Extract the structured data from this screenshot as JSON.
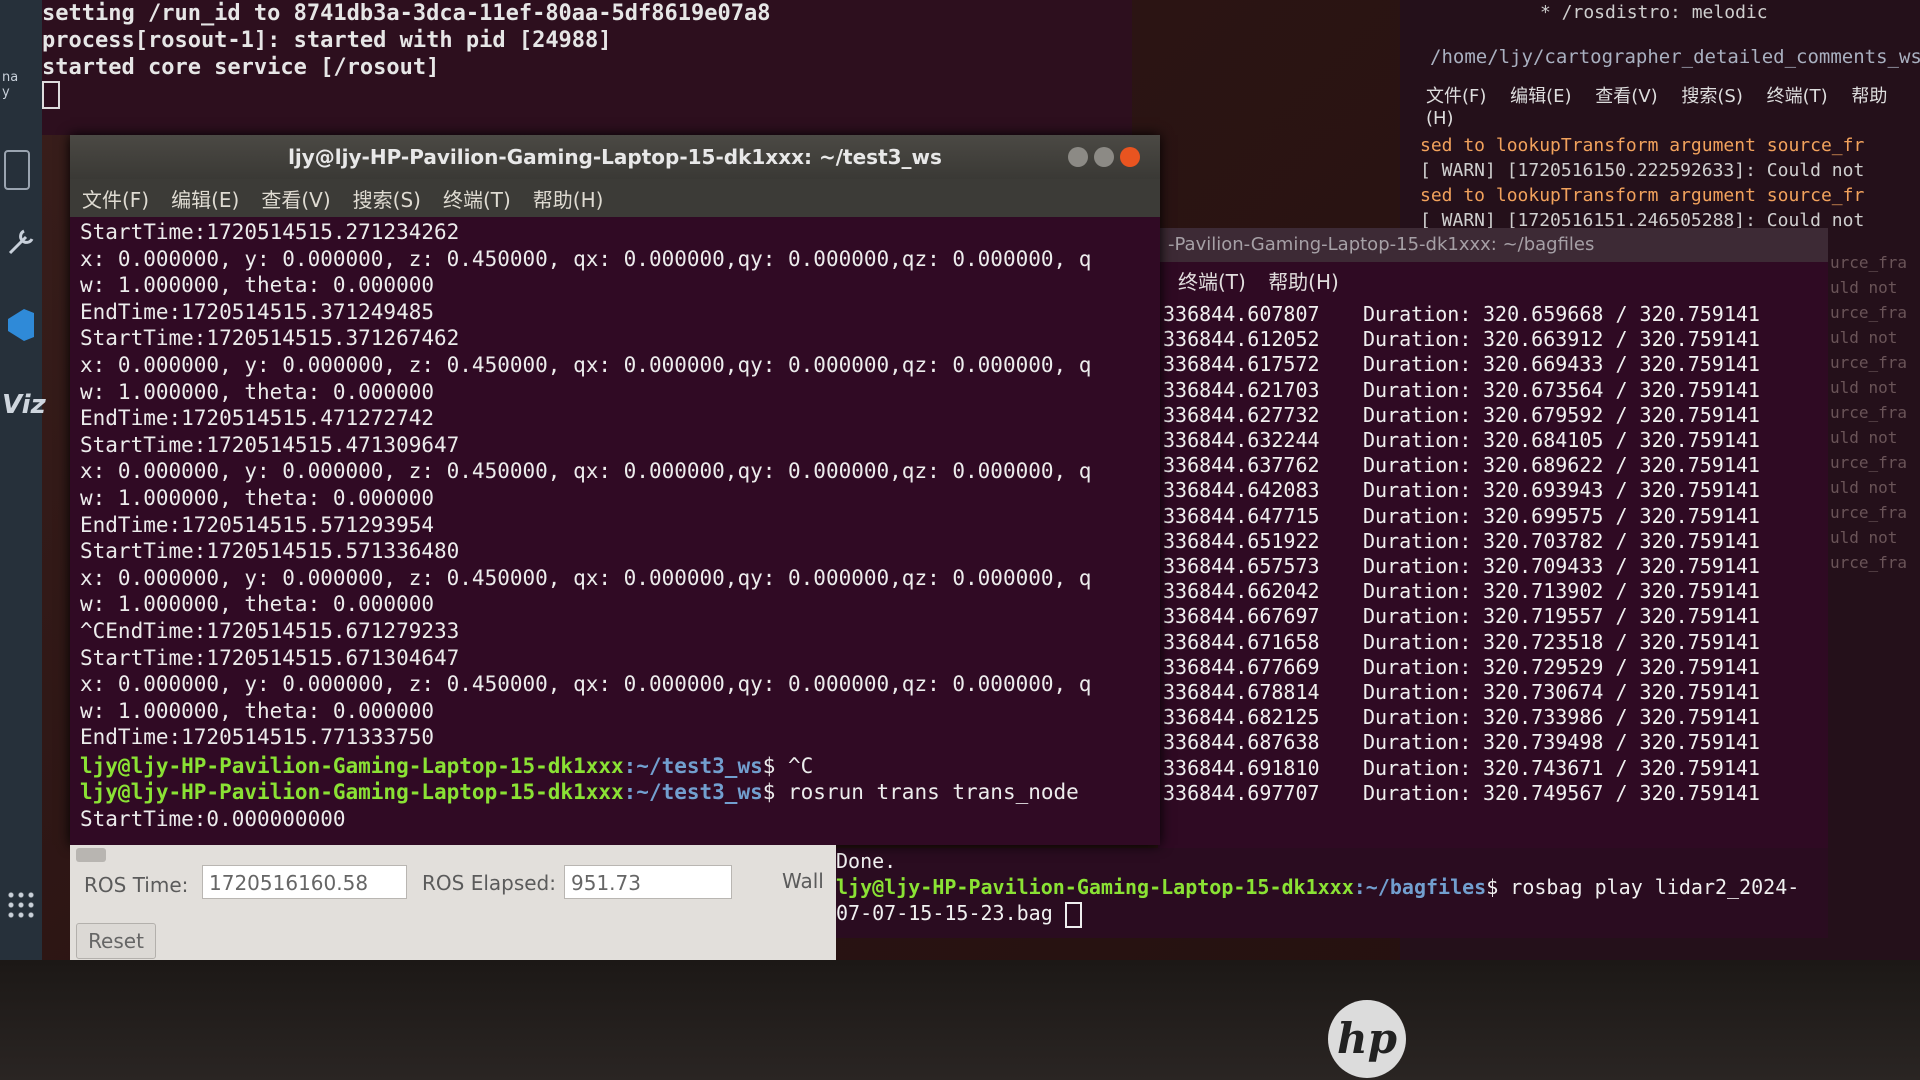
{
  "launcher": {
    "label_top": "na\ny",
    "label_viz": "Viz"
  },
  "bg_terminal": {
    "lines": [
      "setting /run_id to 8741db3a-3dca-11ef-80aa-5df8619e07a8",
      "process[rosout-1]: started with pid [24988]",
      "started core service [/rosout]"
    ]
  },
  "right_terminal": {
    "top_line": "* /rosdistro: melodic",
    "path": "/home/ljy/cartographer_detailed_comments_ws/",
    "menu": [
      "文件(F)",
      "编辑(E)",
      "查看(V)",
      "搜索(S)",
      "终端(T)",
      "帮助(H)"
    ],
    "lines": [
      "sed to lookupTransform argument source_fr",
      "[ WARN] [1720516150.222592633]: Could not",
      "sed to lookupTransform argument source_fr",
      "[ WARN] [1720516151.246505288]: Could not"
    ],
    "ghost": [
      "urce_fra",
      "uld not",
      "urce_fra",
      "uld not",
      "urce_fra",
      "uld not",
      "urce_fra",
      "uld not",
      "urce_fra",
      "uld not",
      "urce_fra",
      "uld not",
      "urce_fra"
    ]
  },
  "main_terminal": {
    "title": "ljy@ljy-HP-Pavilion-Gaming-Laptop-15-dk1xxx: ~/test3_ws",
    "menu": [
      "文件(F)",
      "编辑(E)",
      "查看(V)",
      "搜索(S)",
      "终端(T)",
      "帮助(H)"
    ],
    "lines": [
      "StartTime:1720514515.271234262",
      "x: 0.000000, y: 0.000000, z: 0.450000, qx: 0.000000,qy: 0.000000,qz: 0.000000, q",
      "w: 1.000000, theta: 0.000000",
      "EndTime:1720514515.371249485",
      "StartTime:1720514515.371267462",
      "x: 0.000000, y: 0.000000, z: 0.450000, qx: 0.000000,qy: 0.000000,qz: 0.000000, q",
      "w: 1.000000, theta: 0.000000",
      "EndTime:1720514515.471272742",
      "StartTime:1720514515.471309647",
      "x: 0.000000, y: 0.000000, z: 0.450000, qx: 0.000000,qy: 0.000000,qz: 0.000000, q",
      "w: 1.000000, theta: 0.000000",
      "EndTime:1720514515.571293954",
      "StartTime:1720514515.571336480",
      "x: 0.000000, y: 0.000000, z: 0.450000, qx: 0.000000,qy: 0.000000,qz: 0.000000, q",
      "w: 1.000000, theta: 0.000000",
      "^CEndTime:1720514515.671279233",
      "StartTime:1720514515.671304647",
      "x: 0.000000, y: 0.000000, z: 0.450000, qx: 0.000000,qy: 0.000000,qz: 0.000000, q",
      "w: 1.000000, theta: 0.000000",
      "EndTime:1720514515.771333750"
    ],
    "prompt_user": "ljy@ljy-HP-Pavilion-Gaming-Laptop-15-dk1xxx",
    "prompt_path": ":~/test3_ws",
    "cmd1": "$ ^C",
    "cmd2": "$ rosrun trans trans_node",
    "last_line": "StartTime:0.000000000"
  },
  "bag_terminal": {
    "title": "-Pavilion-Gaming-Laptop-15-dk1xxx: ~/bagfiles",
    "menu": [
      "终端(T)",
      "帮助(H)"
    ],
    "duration_label": "Duration:",
    "total": "320.759141",
    "rows": [
      {
        "ts": "336844.607807",
        "d": "320.659668"
      },
      {
        "ts": "336844.612052",
        "d": "320.663912"
      },
      {
        "ts": "336844.617572",
        "d": "320.669433"
      },
      {
        "ts": "336844.621703",
        "d": "320.673564"
      },
      {
        "ts": "336844.627732",
        "d": "320.679592"
      },
      {
        "ts": "336844.632244",
        "d": "320.684105"
      },
      {
        "ts": "336844.637762",
        "d": "320.689622"
      },
      {
        "ts": "336844.642083",
        "d": "320.693943"
      },
      {
        "ts": "336844.647715",
        "d": "320.699575"
      },
      {
        "ts": "336844.651922",
        "d": "320.703782"
      },
      {
        "ts": "336844.657573",
        "d": "320.709433"
      },
      {
        "ts": "336844.662042",
        "d": "320.713902"
      },
      {
        "ts": "336844.667697",
        "d": "320.719557"
      },
      {
        "ts": "336844.671658",
        "d": "320.723518"
      },
      {
        "ts": "336844.677669",
        "d": "320.729529"
      },
      {
        "ts": "336844.678814",
        "d": "320.730674"
      },
      {
        "ts": "336844.682125",
        "d": "320.733986"
      },
      {
        "ts": "336844.687638",
        "d": "320.739498"
      },
      {
        "ts": "336844.691810",
        "d": "320.743671"
      },
      {
        "ts": "336844.697707",
        "d": "320.749567"
      }
    ],
    "done": "Done.",
    "prompt_user": "ljy@ljy-HP-Pavilion-Gaming-Laptop-15-dk1xxx",
    "prompt_path": ":~/bagfiles",
    "cmd": "$ rosbag play lidar2_2024-",
    "cmd_cont": "07-07-15-15-23.bag"
  },
  "rqt_time": {
    "ros_time_label": "ROS Time:",
    "ros_time_value": "1720516160.58",
    "ros_elapsed_label": "ROS Elapsed:",
    "ros_elapsed_value": "951.73",
    "wall_label": "Wall",
    "reset_label": "Reset"
  },
  "colors": {
    "prompt_user": "#8ae234",
    "prompt_path": "#729fcf",
    "terminal_bg": "#300a24"
  },
  "brand": "hp"
}
